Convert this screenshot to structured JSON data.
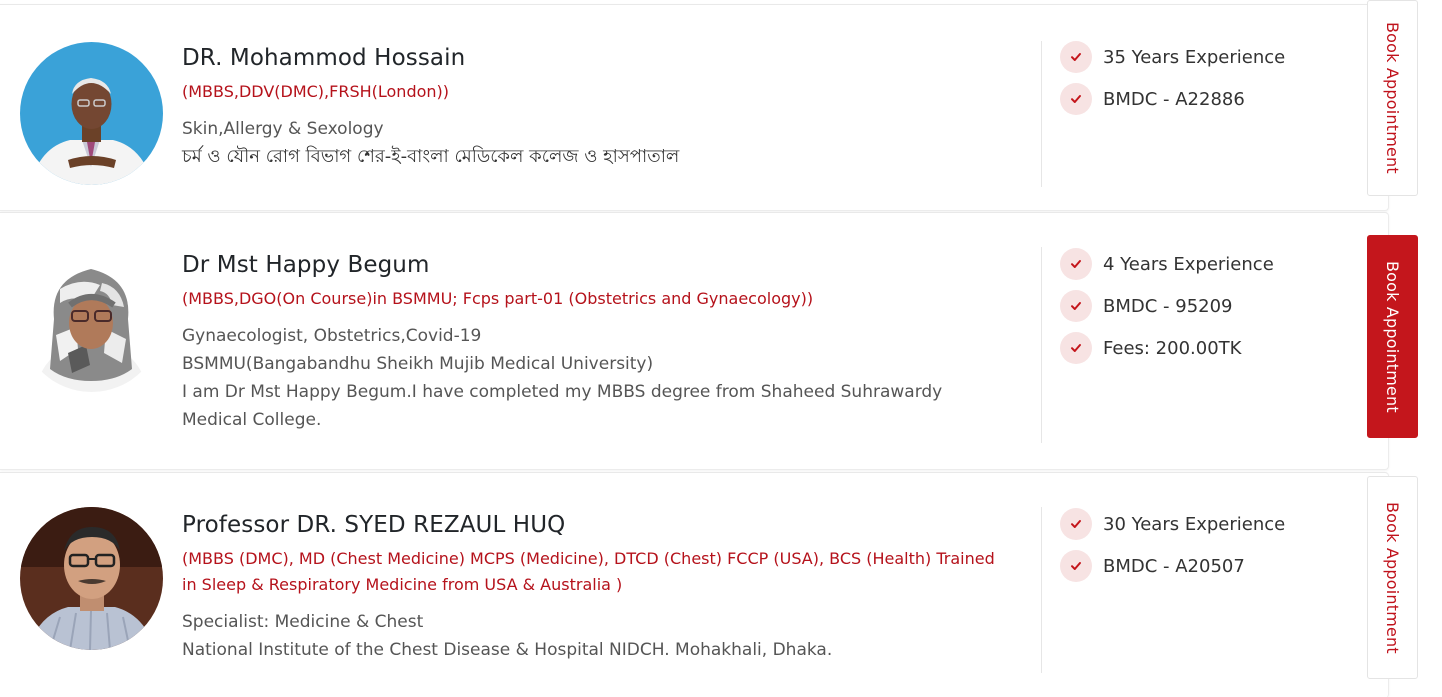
{
  "colors": {
    "accent": "#c4161c",
    "degree_text": "#b5121b",
    "check_bg": "#f7e3e3"
  },
  "doctors": [
    {
      "name": "DR. Mohammod Hossain",
      "degree": "(MBBS,DDV(DMC),FRSH(London))",
      "lines": [
        "Skin,Allergy & Sexology"
      ],
      "bangla_line": "চর্ম ও যৌন রোগ বিভাগ শের-ই-বাংলা মেডিকেল কলেজ ও হাসপাতাল",
      "stats": [
        "35 Years Experience",
        "BMDC - A22886"
      ],
      "button": "Book Appointment"
    },
    {
      "name": "Dr Mst Happy Begum",
      "degree": "(MBBS,DGO(On Course)in BSMMU; Fcps part-01 (Obstetrics and Gynaecology))",
      "lines": [
        "Gynaecologist, Obstetrics,Covid-19",
        "BSMMU(Bangabandhu Sheikh Mujib Medical University)",
        "I am Dr Mst Happy Begum.I have completed my MBBS degree from Shaheed  Suhrawardy Medical College."
      ],
      "stats": [
        "4 Years Experience",
        "BMDC - 95209",
        "Fees: 200.00TK"
      ],
      "button": "Book Appointment"
    },
    {
      "name": "Professor DR. SYED REZAUL HUQ",
      "degree": "(MBBS (DMC), MD (Chest Medicine) MCPS (Medicine), DTCD (Chest) FCCP (USA), BCS (Health) Trained in Sleep & Respiratory Medicine from USA & Australia )",
      "lines": [
        "Specialist: Medicine & Chest",
        "National Institute of the Chest Disease & Hospital NIDCH. Mohakhali, Dhaka."
      ],
      "stats": [
        "30 Years Experience",
        "BMDC - A20507"
      ],
      "button": "Book Appointment"
    }
  ]
}
